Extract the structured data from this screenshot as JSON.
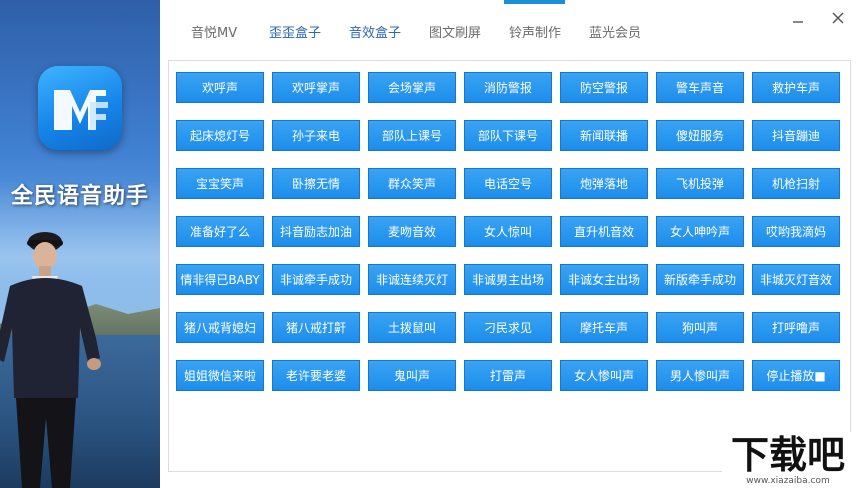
{
  "app": {
    "name": "全民语音助手"
  },
  "colors": {
    "accent": "#1a8fd8",
    "button_bg": "#2596ef",
    "tab_active": "#2a66b1",
    "tab_inactive": "#6b6b6b"
  },
  "tabs": [
    {
      "label": "音悦MV",
      "state": "normal"
    },
    {
      "label": "歪歪盒子",
      "state": "hover"
    },
    {
      "label": "音效盒子",
      "state": "active"
    },
    {
      "label": "图文刷屏",
      "state": "normal"
    },
    {
      "label": "铃声制作",
      "state": "normal"
    },
    {
      "label": "蓝光会员",
      "state": "normal"
    }
  ],
  "window": {
    "minimize_icon": "minimize-icon",
    "close_icon": "close-icon"
  },
  "sounds": [
    "欢呼声",
    "欢呼掌声",
    "会场掌声",
    "消防警报",
    "防空警报",
    "警车声音",
    "救护车声",
    "起床熄灯号",
    "孙子来电",
    "部队上课号",
    "部队下课号",
    "新闻联播",
    "傻妞服务",
    "抖音蹦迪",
    "宝宝笑声",
    "卧擦无情",
    "群众笑声",
    "电话空号",
    "炮弹落地",
    "飞机投弹",
    "机枪扫射",
    "准备好了么",
    "抖音励志加油",
    "麦吻音效",
    "女人惊叫",
    "直升机音效",
    "女人呻吟声",
    "哎哟我滴妈",
    "情非得已BABY",
    "非诚牵手成功",
    "非诚连续灭灯",
    "非诚男主出场",
    "非诚女主出场",
    "新版牵手成功",
    "非城灭灯音效",
    "猪八戒背媳妇",
    "猪八戒打鼾",
    "土拨鼠叫",
    "刁民求见",
    "摩托车声",
    "狗叫声",
    "打呼噜声",
    "姐姐微信来啦",
    "老许要老婆",
    "鬼叫声",
    "打雷声",
    "女人惨叫声",
    "男人惨叫声",
    "停止播放■"
  ],
  "watermark": {
    "logo_text": "下载吧",
    "url": "www.xiazaiba.com"
  }
}
